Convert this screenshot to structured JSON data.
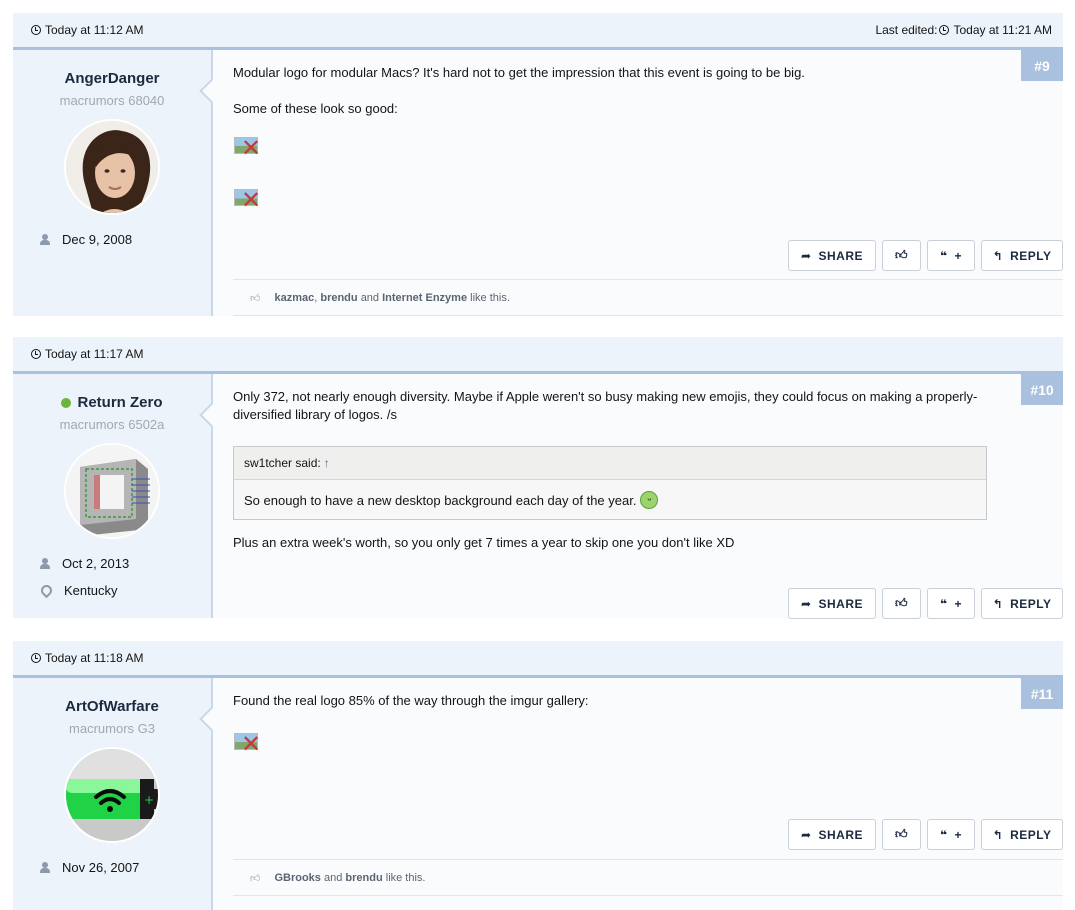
{
  "labels": {
    "share": "SHARE",
    "reply": "REPLY",
    "quote_plus": "+",
    "quote_marks": "66",
    "last_edited": "Last edited:",
    "like_this": "like this.",
    "and": "and"
  },
  "posts": [
    {
      "time": "Today at 11:12 AM",
      "edited_time": "Today at 11:21 AM",
      "number": "#9",
      "username": "AngerDanger",
      "usertitle": "macrumors 68040",
      "joined": "Dec 9, 2008",
      "message": [
        "Modular logo for modular Macs? It's hard not to get the impression that this event is going to be big.",
        "Some of these look so good:"
      ],
      "likers": [
        "kazmac",
        "brendu",
        "Internet Enzyme"
      ]
    },
    {
      "time": "Today at 11:17 AM",
      "number": "#10",
      "username": "Return Zero",
      "online": true,
      "usertitle": "macrumors 6502a",
      "joined": "Oct 2, 2013",
      "location": "Kentucky",
      "message": [
        "Only 372, not nearly enough diversity. Maybe if Apple weren't so busy making new emojis, they could focus on making a properly-diversified library of logos. /s"
      ],
      "quote_author": "sw1tcher said:",
      "quote_arrow": "↑",
      "quote_text": "So enough to have a new desktop background each day of the year.",
      "message_after": "Plus an extra week's worth, so you only get 7 times a year to skip one you don't like XD"
    },
    {
      "time": "Today at 11:18 AM",
      "number": "#11",
      "username": "ArtOfWarfare",
      "usertitle": "macrumors G3",
      "joined": "Nov 26, 2007",
      "message": [
        "Found the real logo 85% of the way through the imgur gallery:"
      ],
      "likers": [
        "GBrooks",
        "brendu"
      ]
    }
  ]
}
